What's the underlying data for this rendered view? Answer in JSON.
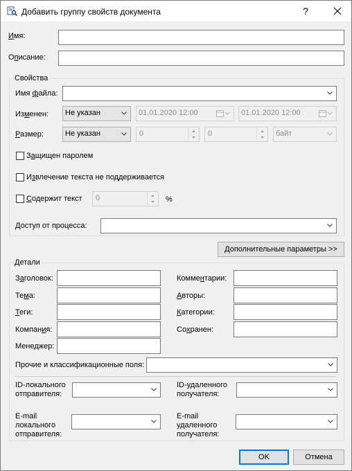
{
  "window": {
    "title": "Добавить группу свойств документа",
    "help_label": "?"
  },
  "name": {
    "label_u": "И",
    "label": "мя:",
    "value": ""
  },
  "description": {
    "label_pre": "О",
    "label_u": "п",
    "label": "исание:",
    "value": ""
  },
  "properties": {
    "group_title": "Свойства",
    "filename": {
      "label_pre": "Имя ",
      "label_u": "ф",
      "label": "айла:",
      "value": ""
    },
    "modified": {
      "label_pre": "Из",
      "label_u": "м",
      "label": "енен:",
      "mode": "Не указан",
      "from": "01.01.2020 12:00",
      "to": "01.01.2020 12:00"
    },
    "size": {
      "label_u": "Р",
      "label": "азмер:",
      "mode": "Не указан",
      "from": "0",
      "to": "0",
      "unit": "байт"
    },
    "password_protected": {
      "label_pre": "З",
      "label_u": "а",
      "label": "щищен паролем",
      "checked": false
    },
    "extraction_unsupported": {
      "label_pre": "И",
      "label_u": "з",
      "label": "влечение текста не поддерживается",
      "checked": false
    },
    "contains_text": {
      "label_u": "С",
      "label": "одержит текст",
      "checked": false,
      "value": "0",
      "unit": "%"
    },
    "process_access": {
      "label": "Доступ от процесса:",
      "value": ""
    }
  },
  "advanced_button": "Дополнительные параметры >>",
  "details": {
    "group_title": "Детали",
    "title_field": {
      "label_pre": "З",
      "label_u": "а",
      "label": "головок:",
      "value": ""
    },
    "subject": {
      "label_pre": "Те",
      "label_u": "м",
      "label": "а:",
      "value": ""
    },
    "tags": {
      "label_u": "Т",
      "label": "еги:",
      "value": ""
    },
    "company": {
      "label_pre": "Компан",
      "label_u": "и",
      "label": "я:",
      "value": ""
    },
    "manager": {
      "label_pre": "Мене",
      "label_u": "д",
      "label": "жер:",
      "value": ""
    },
    "comments": {
      "label_pre": "Комме",
      "label_u": "н",
      "label": "тарии:",
      "value": ""
    },
    "authors": {
      "label_u": "А",
      "label": "вторы:",
      "value": ""
    },
    "categories": {
      "label_u": "К",
      "label": "атегории:",
      "value": ""
    },
    "saved": {
      "label_pre": "Со",
      "label_u": "х",
      "label": "ранен:",
      "value": ""
    },
    "other_fields": {
      "label": "Прочие и классификационные поля:",
      "value": ""
    },
    "local_sender_id": {
      "label": "ID-локального отправителя:",
      "value": ""
    },
    "remote_recipient_id": {
      "label": "ID-удаленного получателя:",
      "value": ""
    },
    "local_sender_email": {
      "label": "E-mail локального отправителя:",
      "value": ""
    },
    "remote_recipient_email": {
      "label": "E-mail удаленного получателя:",
      "value": ""
    }
  },
  "ok_button": "OK",
  "cancel_button": "Отмена",
  "colors": {
    "accent": "#0078d7",
    "border": "#7a7a7a",
    "disabled": "#8c8c8c"
  },
  "icons": [
    "document-search-icon",
    "close-icon",
    "chevron-down-icon",
    "calendar-icon",
    "spin-up-icon",
    "spin-down-icon"
  ]
}
